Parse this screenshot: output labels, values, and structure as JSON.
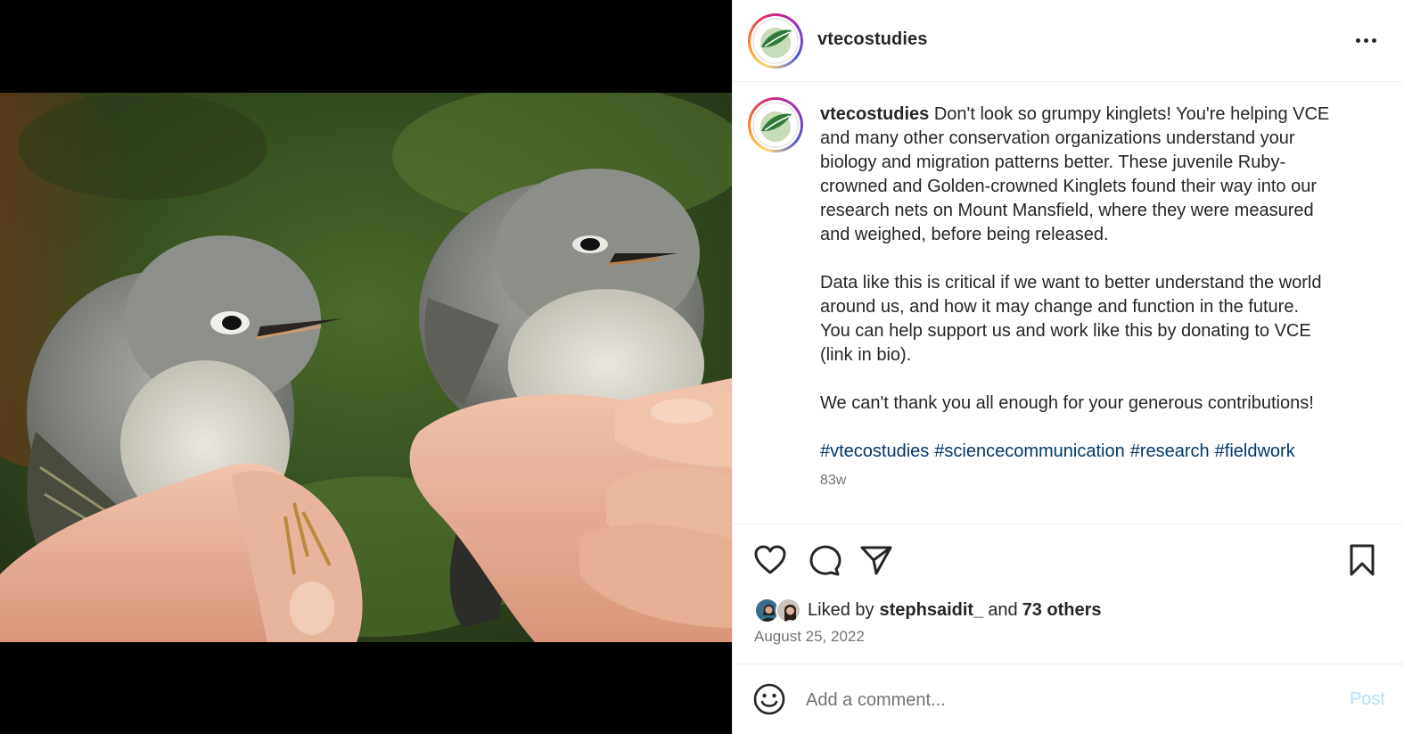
{
  "post": {
    "username": "vtecostudies",
    "caption_username": "vtecostudies",
    "caption_text": " Don't look so grumpy kinglets! You're helping VCE\nand many other conservation organizations understand your\nbiology and migration patterns better. These juvenile Ruby-\ncrowned and Golden-crowned Kinglets found their way into our\nresearch nets on Mount Mansfield, where they were measured\nand weighed, before being released.\n\nData like this is critical if we want to better understand the world\naround us, and how it may change and function in the future.\nYou can help support us and work like this by donating to VCE\n(link in bio).\n\nWe can't thank you all enough for your generous contributions!",
    "hashtags": [
      "#vtecostudies",
      "#sciencecommunication",
      "#research",
      "#fieldwork"
    ],
    "age": "83w",
    "likes": {
      "prefix": "Liked by",
      "user": "stephsaidit_",
      "joiner": "and",
      "others": "73 others"
    },
    "date": "August 25, 2022"
  },
  "comment": {
    "placeholder": "Add a comment...",
    "post_label": "Post"
  },
  "icons": {
    "more": "more-options-icon",
    "like": "heart-icon",
    "comment": "comment-bubble-icon",
    "share": "paper-plane-icon",
    "save": "bookmark-icon",
    "emoji": "smiley-icon"
  },
  "colors": {
    "hashtag": "#00376b",
    "muted": "#737373",
    "post_disabled": "#b2dffc",
    "text": "#262626"
  }
}
